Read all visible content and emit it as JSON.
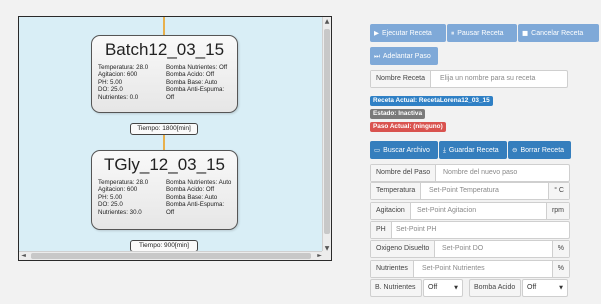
{
  "diagram": {
    "nodes": [
      {
        "title": "Batch12_03_15",
        "left": [
          "Temperatura: 28.0",
          "Agitacion: 600",
          "PH: 5.00",
          "DO: 25.0",
          "Nutrientes: 0.0"
        ],
        "right": [
          "Bomba Nutrientes: Off",
          "Bomba Acido: Off",
          "Bomba Base: Auto",
          "Bomba Anti-Espuma: Off"
        ]
      },
      {
        "title": "TGly_12_03_15",
        "left": [
          "Temperatura: 28.0",
          "Agitacion: 600",
          "PH: 5.00",
          "DO: 25.0",
          "Nutrientes: 30.0"
        ],
        "right": [
          "Bomba Nutrientes: Auto",
          "Bomba Acido: Off",
          "Bomba Base: Auto",
          "Bomba Anti-Espuma: Off"
        ]
      }
    ],
    "times": [
      "Tiempo: 1800[min]",
      "Tiempo: 900[min]"
    ],
    "scroll_icons": {
      "up": "▲",
      "down": "▼",
      "left": "◄",
      "right": "►"
    }
  },
  "controls": {
    "execute": {
      "icon": "▶",
      "label": "Ejecutar Receta"
    },
    "pause": {
      "icon": "⏸",
      "label": "Pausar Receta"
    },
    "cancel": {
      "icon": "■",
      "label": "Cancelar Receta"
    },
    "advance": {
      "icon": "⏭",
      "label": "Adelantar Paso"
    }
  },
  "recipe_name": {
    "label": "Nombre Receta",
    "placeholder": "Elija un nombre para su receta"
  },
  "status": {
    "current_recipe": "Receta Actual: RecetaLorena12_03_15",
    "state": "Estado: Inactiva",
    "current_step": "Paso Actual: (ninguno)"
  },
  "file_actions": {
    "search": {
      "icon": "▭",
      "label": "Buscar Archivo"
    },
    "save": {
      "icon": "⤓",
      "label": "Guardar Receta"
    },
    "delete": {
      "icon": "⊖",
      "label": "Borrar Receta"
    }
  },
  "step_form": {
    "step_name": {
      "label": "Nombre del Paso",
      "placeholder": "Nombre del nuevo paso"
    },
    "temperature": {
      "label": "Temperatura",
      "placeholder": "Set-Point Temperatura",
      "unit": "° C"
    },
    "agitation": {
      "label": "Agitacion",
      "placeholder": "Set-Point Agitacion",
      "unit": "rpm"
    },
    "ph": {
      "label": "PH",
      "placeholder": "Set-Point PH"
    },
    "oxygen": {
      "label": "Oxigeno Disuelto",
      "placeholder": "Set-Point DO",
      "unit": "%"
    },
    "nutrients": {
      "label": "Nutrientes",
      "placeholder": "Set-Point Nutrientes",
      "unit": "%"
    },
    "pumps": {
      "nutrients_label": "B. Nutrientes",
      "nutrients_value": "Off",
      "acid_label": "Bomba Acido",
      "acid_value": "Off",
      "caret": "▼"
    }
  }
}
